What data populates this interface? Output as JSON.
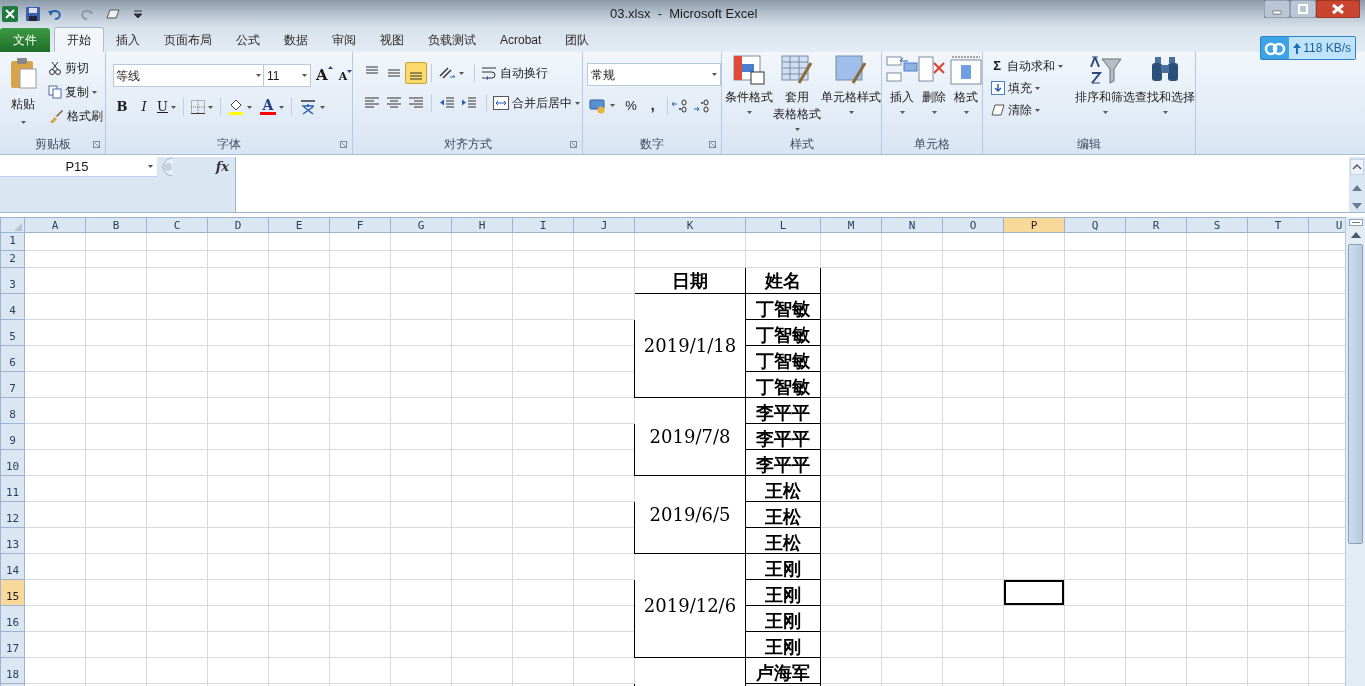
{
  "window": {
    "title": "03.xlsx  -  Microsoft Excel"
  },
  "tabs": [
    {
      "label": "文件",
      "kind": "file",
      "selected": false
    },
    {
      "label": "开始",
      "kind": "tab",
      "selected": true
    },
    {
      "label": "插入",
      "kind": "tab",
      "selected": false
    },
    {
      "label": "页面布局",
      "kind": "tab",
      "selected": false
    },
    {
      "label": "公式",
      "kind": "tab",
      "selected": false
    },
    {
      "label": "数据",
      "kind": "tab",
      "selected": false
    },
    {
      "label": "审阅",
      "kind": "tab",
      "selected": false
    },
    {
      "label": "视图",
      "kind": "tab",
      "selected": false
    },
    {
      "label": "负载测试",
      "kind": "tab",
      "selected": false
    },
    {
      "label": "Acrobat",
      "kind": "tab",
      "selected": false
    },
    {
      "label": "团队",
      "kind": "tab",
      "selected": false
    }
  ],
  "network_badge": {
    "speed": "118 KB/s"
  },
  "ribbon": {
    "clipboard": {
      "label": "剪贴板",
      "paste": "粘贴",
      "cut": "剪切",
      "copy": "复制",
      "format_painter": "格式刷"
    },
    "font": {
      "label": "字体",
      "font_name": "等线",
      "font_size": "11",
      "grow": "A",
      "shrink": "A",
      "bold": "B",
      "italic": "I",
      "underline": "U",
      "font_color": "A"
    },
    "alignment": {
      "label": "对齐方式",
      "vertical": [
        {
          "selected": false
        },
        {
          "selected": false
        },
        {
          "selected": true
        }
      ],
      "wrap_text": "自动换行",
      "merge_center": "合并后居中"
    },
    "number": {
      "label": "数字",
      "format": "常规",
      "percent": "%",
      "comma": ","
    },
    "styles": {
      "label": "样式",
      "buttons": [
        {
          "lines": [
            "条件格式"
          ]
        },
        {
          "lines": [
            "套用",
            "表格格式"
          ]
        },
        {
          "lines": [
            "单元格样式"
          ]
        }
      ]
    },
    "cells": {
      "label": "单元格",
      "buttons": [
        {
          "lines": [
            "插入"
          ]
        },
        {
          "lines": [
            "删除"
          ]
        },
        {
          "lines": [
            "格式"
          ]
        }
      ]
    },
    "editing": {
      "label": "编辑",
      "sigma": "Σ",
      "autosum": "自动求和",
      "fill": "填充",
      "clear": "清除",
      "sort": "排序和筛选",
      "find": "查找和选择"
    }
  },
  "formula_bar": {
    "name_box": "P15",
    "fx": "fx"
  },
  "sheet": {
    "columns": [
      {
        "label": "A",
        "selected": false
      },
      {
        "label": "B",
        "selected": false
      },
      {
        "label": "C",
        "selected": false
      },
      {
        "label": "D",
        "selected": false
      },
      {
        "label": "E",
        "selected": false
      },
      {
        "label": "F",
        "selected": false
      },
      {
        "label": "G",
        "selected": false
      },
      {
        "label": "H",
        "selected": false
      },
      {
        "label": "I",
        "selected": false
      },
      {
        "label": "J",
        "selected": false
      },
      {
        "label": "K",
        "selected": false
      },
      {
        "label": "L",
        "selected": false
      },
      {
        "label": "M",
        "selected": false
      },
      {
        "label": "N",
        "selected": false
      },
      {
        "label": "O",
        "selected": false
      },
      {
        "label": "P",
        "selected": true
      },
      {
        "label": "Q",
        "selected": false
      },
      {
        "label": "R",
        "selected": false
      },
      {
        "label": "S",
        "selected": false
      },
      {
        "label": "T",
        "selected": false
      },
      {
        "label": "U",
        "selected": false
      }
    ],
    "rows": [
      {
        "label": "1",
        "selected": false
      },
      {
        "label": "2",
        "selected": false
      },
      {
        "label": "3",
        "selected": false
      },
      {
        "label": "4",
        "selected": false
      },
      {
        "label": "5",
        "selected": false
      },
      {
        "label": "6",
        "selected": false
      },
      {
        "label": "7",
        "selected": false
      },
      {
        "label": "8",
        "selected": false
      },
      {
        "label": "9",
        "selected": false
      },
      {
        "label": "10",
        "selected": false
      },
      {
        "label": "11",
        "selected": false
      },
      {
        "label": "12",
        "selected": false
      },
      {
        "label": "13",
        "selected": false
      },
      {
        "label": "14",
        "selected": false
      },
      {
        "label": "15",
        "selected": true
      },
      {
        "label": "16",
        "selected": false
      },
      {
        "label": "17",
        "selected": false
      },
      {
        "label": "18",
        "selected": false
      }
    ],
    "table_headers": [
      "日期",
      "姓名"
    ],
    "groups": [
      {
        "date": "2019/1/18",
        "names": [
          "丁智敏",
          "丁智敏",
          "丁智敏",
          "丁智敏"
        ]
      },
      {
        "date": "2019/7/8",
        "names": [
          "李平平",
          "李平平",
          "李平平"
        ]
      },
      {
        "date": "2019/6/5",
        "names": [
          "王松",
          "王松",
          "王松"
        ]
      },
      {
        "date": "2019/12/6",
        "names": [
          "王刚",
          "王刚",
          "王刚",
          "王刚"
        ]
      },
      {
        "names": [
          "卢海军"
        ]
      }
    ]
  }
}
